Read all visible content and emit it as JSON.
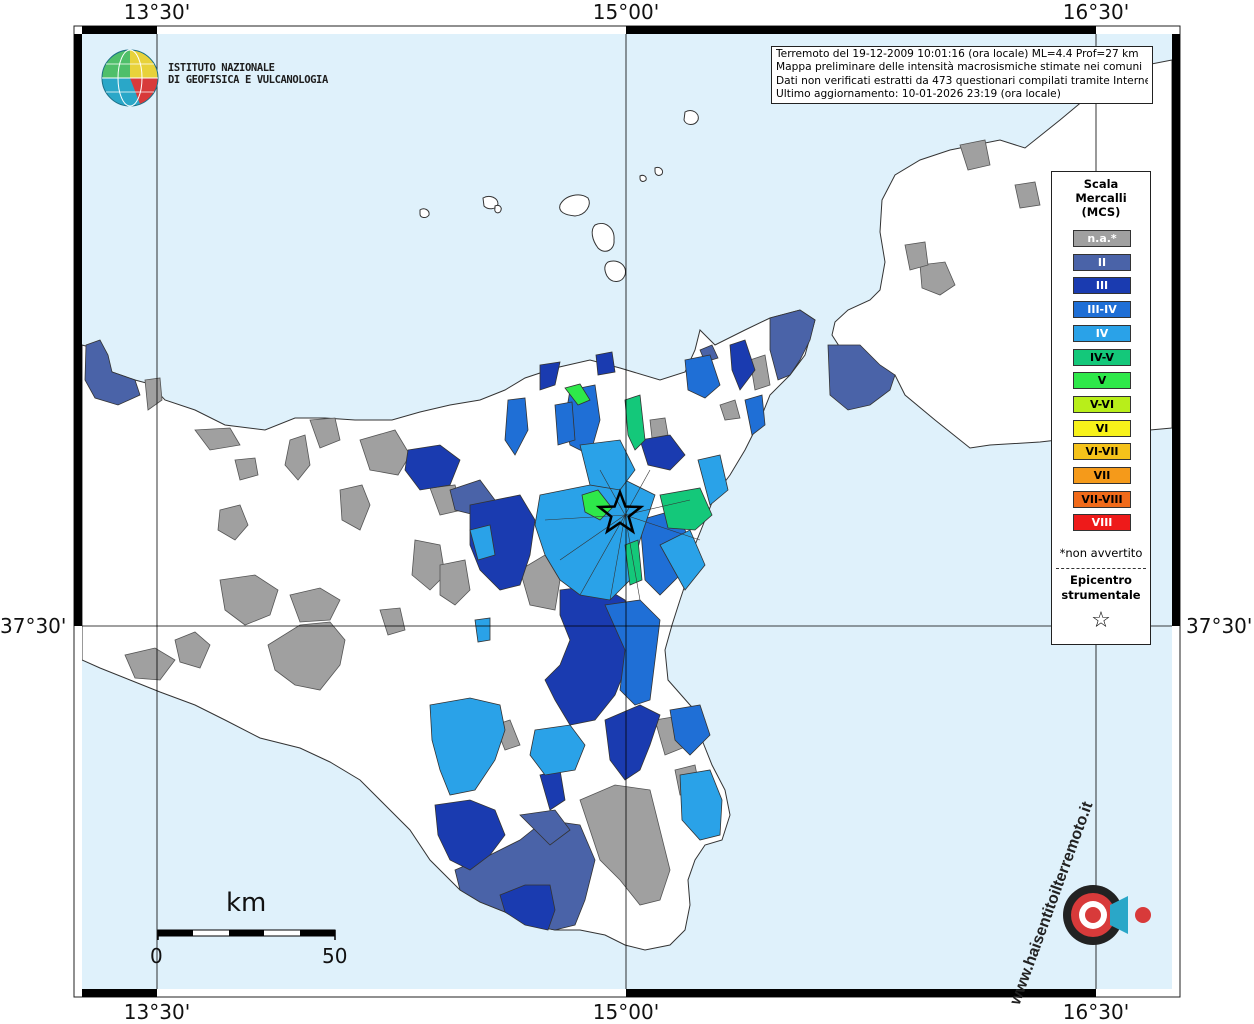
{
  "coords": {
    "top": [
      "13°30'",
      "15°00'",
      "16°30'"
    ],
    "bottom": [
      "13°30'",
      "15°00'",
      "16°30'"
    ],
    "lat_left": "37°30'",
    "lat_right": "37°30'"
  },
  "info": {
    "line1": "Terremoto del 19-12-2009 10:01:16 (ora locale) ML=4.4 Prof=27 km",
    "line2": "Mappa preliminare delle intensità macrosismiche stimate nei comuni",
    "line3": "Dati non verificati estratti da 473 questionari compilati tramite Internet.",
    "line4": "Ultimo aggiornamento: 10-01-2026 23:19 (ora locale)"
  },
  "logo": {
    "line1": "ISTITUTO NAZIONALE",
    "line2": "DI GEOFISICA E VULCANOLOGIA"
  },
  "legend": {
    "title1": "Scala",
    "title2": "Mercalli",
    "title3": "(MCS)",
    "items": [
      {
        "label": "n.a.*",
        "color": "#a0a0a0",
        "text": "#ffffff"
      },
      {
        "label": "II",
        "color": "#4a63a8",
        "text": "#ffffff"
      },
      {
        "label": "III",
        "color": "#1a3bb0",
        "text": "#ffffff"
      },
      {
        "label": "III-IV",
        "color": "#1f6fd6",
        "text": "#ffffff"
      },
      {
        "label": "IV",
        "color": "#2aa2e8",
        "text": "#ffffff"
      },
      {
        "label": "IV-V",
        "color": "#14c87a",
        "text": "#000000"
      },
      {
        "label": "V",
        "color": "#2ee84a",
        "text": "#000000"
      },
      {
        "label": "V-VI",
        "color": "#b8ee1a",
        "text": "#000000"
      },
      {
        "label": "VI",
        "color": "#f7f21a",
        "text": "#000000"
      },
      {
        "label": "VI-VII",
        "color": "#f5c21a",
        "text": "#000000"
      },
      {
        "label": "VII",
        "color": "#f59a1a",
        "text": "#000000"
      },
      {
        "label": "VII-VIII",
        "color": "#f06a1a",
        "text": "#000000"
      },
      {
        "label": "VIII",
        "color": "#ee1a1a",
        "text": "#ffffff"
      }
    ],
    "note": "*non avvertito",
    "epi1": "Epicentro",
    "epi2": "strumentale",
    "star": "☆"
  },
  "scalebar": {
    "unit": "km",
    "zero": "0",
    "max": "50"
  },
  "watermark": {
    "text": "www.haisentitoilterremoto.it"
  }
}
